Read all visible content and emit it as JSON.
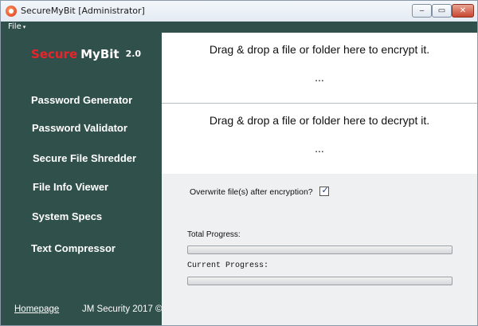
{
  "window": {
    "title": "SecureMyBit [Administrator]",
    "controls": {
      "minimize": "‒",
      "maximize": "▭",
      "close": "✕"
    }
  },
  "menu": {
    "file_label": "File",
    "file_caret": "▾"
  },
  "brand": {
    "secure": "Secure",
    "mybit": "MyBit",
    "version": "2.0"
  },
  "sidebar": {
    "items": [
      {
        "label": "Password Generator"
      },
      {
        "label": "Password Validator"
      },
      {
        "label": "Secure File Shredder"
      },
      {
        "label": "File Info Viewer"
      },
      {
        "label": "System Specs"
      },
      {
        "label": "Text Compressor"
      }
    ],
    "homepage_link": "Homepage",
    "copyright": "JM Security 2017 ©"
  },
  "encrypt_zone": {
    "text": "Drag & drop a file or folder here to encrypt it.",
    "status": "..."
  },
  "decrypt_zone": {
    "text": "Drag & drop a file or folder here to decrypt it.",
    "status": "..."
  },
  "options": {
    "overwrite_label": "Overwrite file(s) after encryption?",
    "overwrite_checked": true,
    "check_glyph": "✓"
  },
  "progress": {
    "total_label": "Total Progress:",
    "total_value": 0,
    "current_label": "Current Progress:",
    "current_value": 0
  },
  "colors": {
    "sidebar_bg": "#30504b",
    "brand_accent": "#e8252b",
    "text_light": "#ffffff"
  }
}
